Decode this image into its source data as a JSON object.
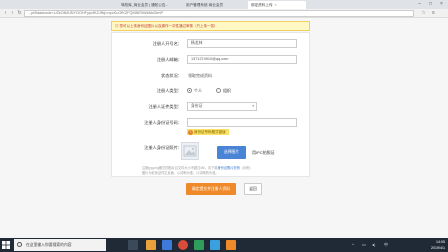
{
  "browser": {
    "tabs": [
      {
        "label": "驾校库_商业会员 | 通知公告...",
        "active": false
      },
      {
        "label": "用户管理系统-商业会员",
        "active": false
      },
      {
        "label": "绑定资料上传",
        "active": true
      }
    ],
    "address": "...pi/flaadcode=UZkOfk5JNYOOHFypcfKZJfNj=npcKuOfKZFQMNE9Wk8tcDbnP"
  },
  "notice": "◎ 您可以上传身份证图片以及操作一次性通过审核（只上传一张）",
  "form": {
    "applicant_label": "注册人开号名：",
    "applicant_value": "杨龙林",
    "email_label": "注册人邮箱：",
    "email_value": "1371274910@qq.com",
    "status_label": "状态状况：",
    "status_value": "领取完成资料",
    "type_label": "注册人类型：",
    "type_options": [
      "个人",
      "组织"
    ],
    "id_type_label": "注册人证件类型：",
    "id_type_value": "身份证",
    "id_number_label": "注册人身份证号码：",
    "id_number_value": "",
    "warning": "身份证号码格式错误",
    "photo_label": "注册人身份证照片：",
    "upload_button": "选择图片",
    "camera_text": "用IPC拍照证",
    "note_line1": "注册jpg.png格式的图片且文件大小不超过4M，请下载",
    "note_link": "身份证照片范例",
    "note_line1_end": "（示例）",
    "note_line2": "图片为彩色证件正反面，以清晰为准，以清晰的为准。"
  },
  "actions": {
    "submit": "确定提交并注册人资料",
    "back": "返回"
  },
  "taskbar": {
    "search_placeholder": "在这里输入你要搜索的内容",
    "time": "14:05",
    "date": "2019/4/1"
  }
}
